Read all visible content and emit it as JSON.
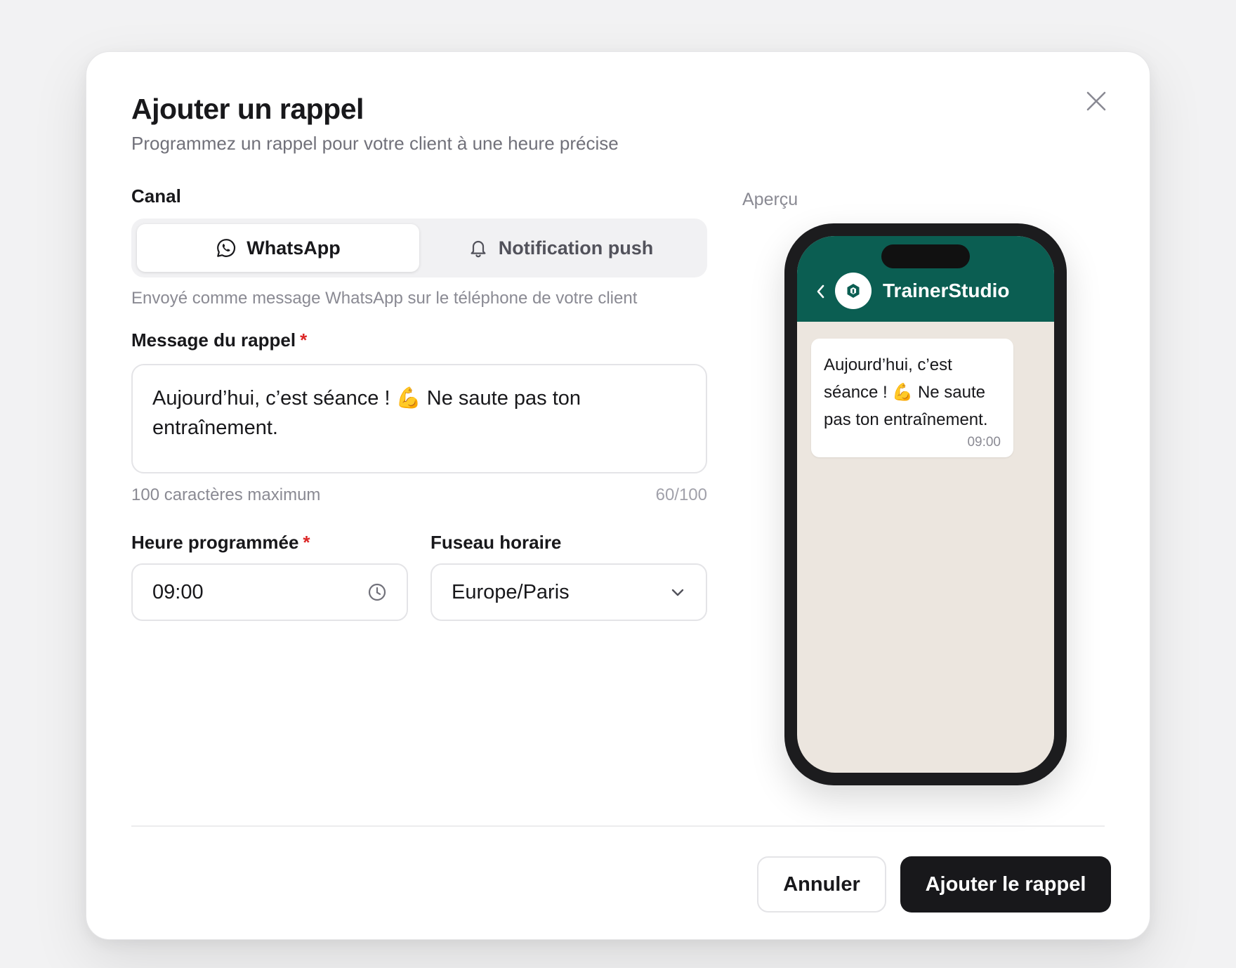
{
  "modal": {
    "title": "Ajouter un rappel",
    "subtitle": "Programmez un rappel pour votre client à une heure précise"
  },
  "channel": {
    "label": "Canal",
    "options": [
      {
        "label": "WhatsApp",
        "icon": "whatsapp-icon",
        "active": true
      },
      {
        "label": "Notification push",
        "icon": "bell-icon",
        "active": false
      }
    ],
    "hint": "Envoyé comme message WhatsApp sur le téléphone de votre client"
  },
  "message": {
    "label": "Message du rappel",
    "required_mark": "*",
    "value": "Aujourd’hui, c’est séance ! 💪 Ne saute pas ton entraînement.",
    "hint": "100 caractères maximum",
    "counter": "60/100"
  },
  "time": {
    "label": "Heure programmée",
    "required_mark": "*",
    "value": "09:00",
    "icon": "clock-icon"
  },
  "timezone": {
    "label": "Fuseau horaire",
    "value": "Europe/Paris",
    "icon": "chevron-down-icon"
  },
  "preview": {
    "label": "Aperçu",
    "contact_name": "TrainerStudio",
    "header_color": "#0b5e52",
    "message": "Aujourd’hui, c’est séance ! 💪 Ne saute pas ton entraînement.",
    "time": "09:00"
  },
  "actions": {
    "cancel": "Annuler",
    "submit": "Ajouter le rappel"
  }
}
